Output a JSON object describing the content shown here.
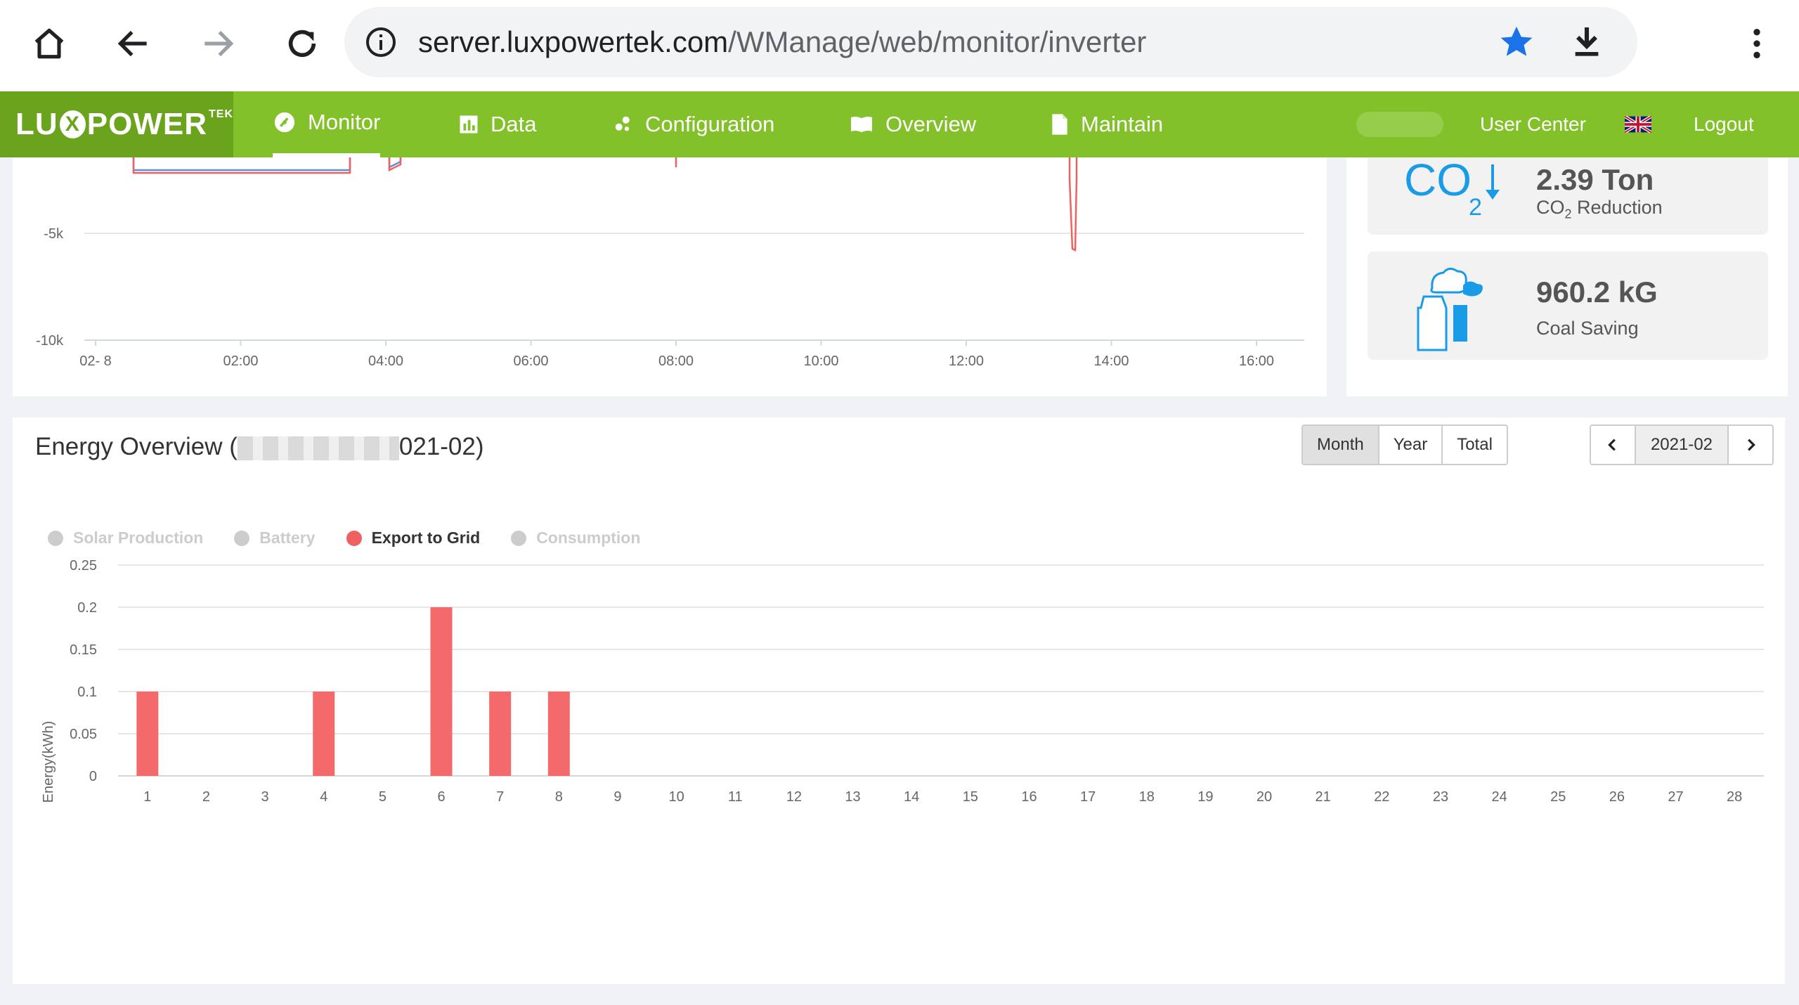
{
  "browser": {
    "url_domain": "server.luxpowertek.com",
    "url_path": "/WManage/web/monitor/inverter"
  },
  "nav": {
    "logo": {
      "pre": "LU",
      "x": "X",
      "post": "POWER",
      "sup": "TEK"
    },
    "items": [
      {
        "label": "Monitor",
        "icon": "dashboard-icon",
        "active": true
      },
      {
        "label": "Data",
        "icon": "bar-chart-icon"
      },
      {
        "label": "Configuration",
        "icon": "config-icon"
      },
      {
        "label": "Overview",
        "icon": "book-icon"
      },
      {
        "label": "Maintain",
        "icon": "document-icon"
      }
    ],
    "user_center": "User Center",
    "logout": "Logout"
  },
  "power_chart": {
    "y_ticks": [
      "-5k",
      "-10k"
    ],
    "x_ticks": [
      "02- 8",
      "02:00",
      "04:00",
      "06:00",
      "08:00",
      "10:00",
      "12:00",
      "14:00",
      "16:00"
    ]
  },
  "stats": {
    "co2": {
      "value": "2.39 Ton",
      "label": "CO",
      "label_sub": "2",
      "label_rest": " Reduction"
    },
    "coal": {
      "value": "960.2 kG",
      "label": "Coal Saving"
    }
  },
  "energy": {
    "title_prefix": "Energy Overview (",
    "title_suffix": "021-02)",
    "buttons": {
      "month": "Month",
      "year": "Year",
      "total": "Total"
    },
    "date": "2021-02",
    "legend": [
      "Solar Production",
      "Battery",
      "Export to Grid",
      "Consumption"
    ]
  },
  "chart_data": {
    "type": "bar",
    "ylabel": "Energy(kWh)",
    "ylim": [
      0,
      0.25
    ],
    "y_ticks": [
      "0",
      "0.05",
      "0.1",
      "0.15",
      "0.2",
      "0.25"
    ],
    "categories": [
      "1",
      "2",
      "3",
      "4",
      "5",
      "6",
      "7",
      "8",
      "9",
      "10",
      "11",
      "12",
      "13",
      "14",
      "15",
      "16",
      "17",
      "18",
      "19",
      "20",
      "21",
      "22",
      "23",
      "24",
      "25",
      "26",
      "27",
      "28"
    ],
    "series": [
      {
        "name": "Export to Grid",
        "color": "#f46a6a",
        "values": [
          0.1,
          0,
          0,
          0.1,
          0,
          0.2,
          0.1,
          0.1,
          0,
          0,
          0,
          0,
          0,
          0,
          0,
          0,
          0,
          0,
          0,
          0,
          0,
          0,
          0,
          0,
          0,
          0,
          0,
          0
        ]
      }
    ],
    "legend_position": "top-left"
  }
}
